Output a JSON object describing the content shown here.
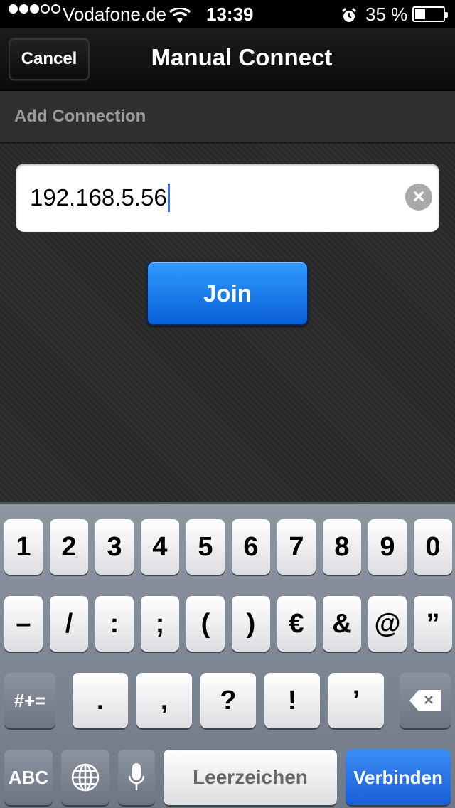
{
  "status_bar": {
    "carrier": "Vodafone.de",
    "time": "13:39",
    "battery": "35 %",
    "battery_level": 0.35,
    "signal_bars": 3,
    "signal_total": 5,
    "icons": [
      "signal-dots-icon",
      "wifi-icon",
      "alarm-clock-icon",
      "battery-icon"
    ]
  },
  "nav": {
    "cancel_label": "Cancel",
    "title": "Manual Connect"
  },
  "section": {
    "label": "Add Connection"
  },
  "form": {
    "ip_value": "192.168.5.56",
    "clear_icon": "clear-text-icon",
    "join_label": "Join"
  },
  "keyboard": {
    "row1": [
      "1",
      "2",
      "3",
      "4",
      "5",
      "6",
      "7",
      "8",
      "9",
      "0"
    ],
    "row2": [
      "–",
      "/",
      ":",
      ";",
      "(",
      ")",
      "€",
      "&",
      "@",
      "”"
    ],
    "row3": {
      "symbols_label": "#+=",
      "punct": [
        ".",
        ",",
        "?",
        "!",
        "’"
      ],
      "backspace_icon": "backspace-icon"
    },
    "row4": {
      "abc_label": "ABC",
      "globe_icon": "globe-icon",
      "mic_icon": "microphone-icon",
      "space_label": "Leerzeichen",
      "return_label": "Verbinden"
    }
  },
  "colors": {
    "accent_blue": "#1a6ee6",
    "caret": "#3b6fe0",
    "background": "#262626",
    "keyboard_bg": "#7d8593"
  }
}
